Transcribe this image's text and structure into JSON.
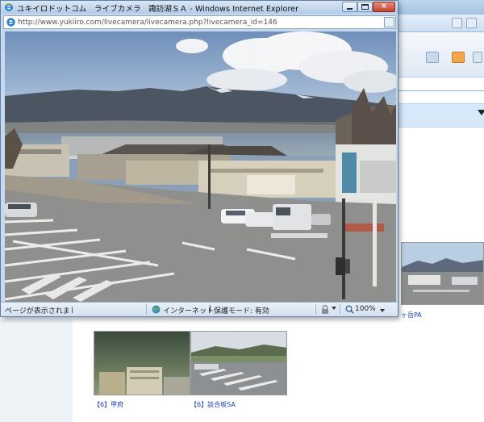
{
  "popup": {
    "title": "ユキイロドットコム　ライブカメラ　諏訪湖ＳＡ - Windows Internet Explorer",
    "address_url": "http://www.yukiiro.com/livecamera/livecamera.php?livecamera_id=146",
    "status_text": "ページが表示されました",
    "zone_text": "インターネット",
    "zone_divider": "|",
    "protected_mode": "保護モード: 有効",
    "zoom": "100%"
  },
  "icons": {
    "window": "ie-icon",
    "address": "page-icon",
    "address_action": "compat-view-icon",
    "minimize": "minimize-icon",
    "maximize": "maximize-icon",
    "close": "close-icon",
    "zone": "globe-icon",
    "tools": "lock-icon",
    "zoom": "zoom-icon",
    "home": "home-icon",
    "feed": "rss-icon",
    "print": "print-icon"
  },
  "background_page": {
    "thumbnails": [
      {
        "label": "ヶ岳PA"
      },
      {
        "label": "【6】甲府"
      },
      {
        "label": "【6】談合坂SA"
      }
    ]
  },
  "colors": {
    "titlebar": "#c6d9ee",
    "close_button": "#c2432e",
    "link": "#1a3fb5"
  }
}
